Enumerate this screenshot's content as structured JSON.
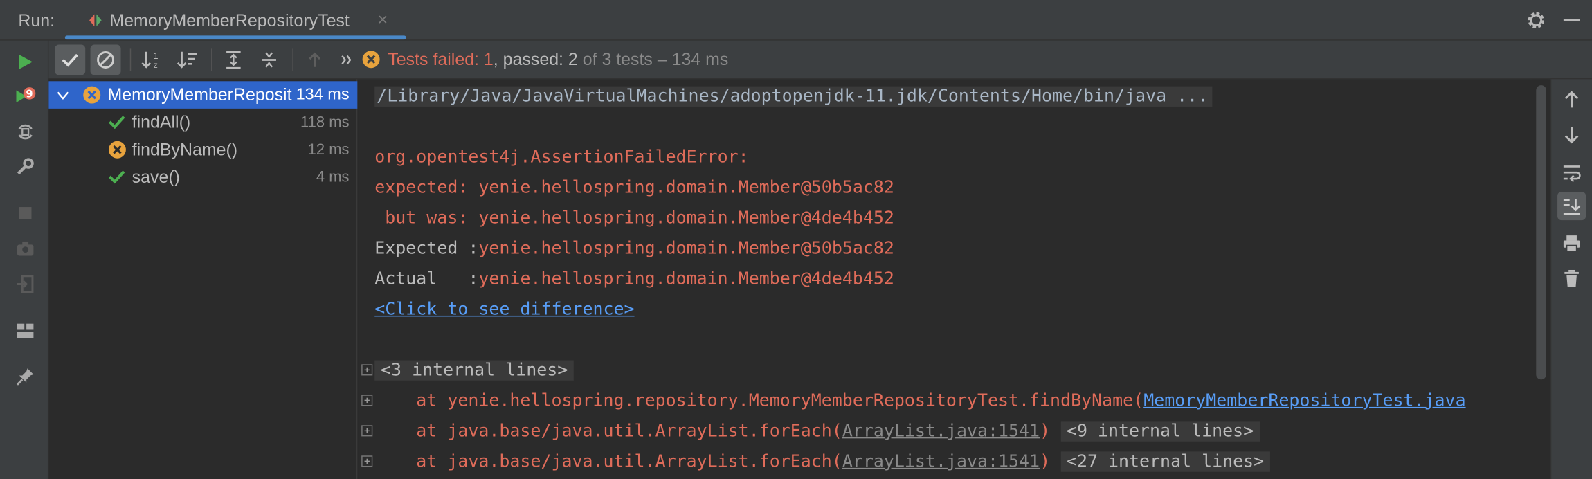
{
  "header": {
    "run_label": "Run:",
    "tab_title": "MemoryMemberRepositoryTest",
    "tab_close": "×"
  },
  "status": {
    "failed_text": "Tests failed: 1",
    "passed_text": ", passed: 2",
    "of_text": " of 3 tests – 134 ms"
  },
  "tree": {
    "root": {
      "label": "MemoryMemberRepositoryTest",
      "time": "134 ms",
      "status": "failed"
    },
    "children": [
      {
        "label": "findAll()",
        "time": "118 ms",
        "status": "passed"
      },
      {
        "label": "findByName()",
        "time": "12 ms",
        "status": "failed"
      },
      {
        "label": "save()",
        "time": "4 ms",
        "status": "passed"
      }
    ]
  },
  "console": {
    "command": "/Library/Java/JavaVirtualMachines/adoptopenjdk-11.jdk/Contents/Home/bin/java ...",
    "error_type": "org.opentest4j.AssertionFailedError:",
    "expected_line": "expected: yenie.hellospring.domain.Member@50b5ac82",
    "but_was_line": " but was: yenie.hellospring.domain.Member@4de4b452",
    "expected_label": "Expected :",
    "expected_value": "yenie.hellospring.domain.Member@50b5ac82",
    "actual_label": "Actual   :",
    "actual_value": "yenie.hellospring.domain.Member@4de4b452",
    "diff_link": "<Click to see difference>",
    "fold1": "<3 internal lines>",
    "stack1_prefix": "    at yenie.hellospring.repository.MemoryMemberRepositoryTest.findByName(",
    "stack1_link": "MemoryMemberRepositoryTest.java",
    "stack2_prefix": "    at java.base/java.util.ArrayList.forEach(",
    "stack2_link": "ArrayList.java:1541",
    "stack2_suffix": ")",
    "fold2": "<9 internal lines>",
    "stack3_prefix": "    at java.base/java.util.ArrayList.forEach(",
    "stack3_link": "ArrayList.java:1541",
    "stack3_suffix": ")",
    "fold3": "<27 internal lines>"
  },
  "colors": {
    "accent": "#4a88c7",
    "selection": "#2f65ca",
    "error": "#e06c5a",
    "pass": "#4caf50",
    "fail_icon": "#e8a33d",
    "link": "#589df6"
  },
  "icons": {
    "left_toolbar": [
      "run-icon",
      "rerun-failed-icon",
      "toggle-auto-test-icon",
      "settings-wrench-icon",
      "stop-icon",
      "screenshot-icon",
      "exit-icon",
      "layout-icon",
      "pin-icon"
    ],
    "tree_toolbar": [
      "show-passed-icon",
      "show-ignored-icon",
      "sort-alphabetically-icon",
      "sort-by-duration-icon",
      "expand-all-icon",
      "collapse-all-icon",
      "previous-failed-icon",
      "more-icon"
    ],
    "right_toolbar": [
      "scroll-up-icon",
      "scroll-down-icon",
      "soft-wrap-icon",
      "scroll-to-end-icon",
      "print-icon",
      "clear-icon"
    ]
  }
}
